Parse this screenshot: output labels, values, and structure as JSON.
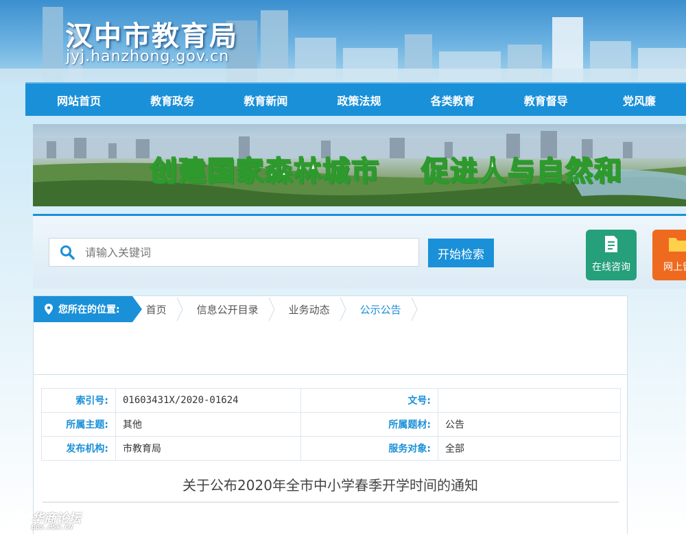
{
  "header": {
    "site_title": "汉中市教育局",
    "site_domain": "jyj.hanzhong.gov.cn"
  },
  "nav": {
    "items": [
      "网站首页",
      "教育政务",
      "教育新闻",
      "政策法规",
      "各类教育",
      "教育督导",
      "党风廉"
    ]
  },
  "banner": {
    "slogan_left": "创建国家森林城市",
    "slogan_right": "促进人与自然和"
  },
  "search": {
    "placeholder": "请输入关键词",
    "button_label": "开始检索"
  },
  "services": {
    "consult_label": "在线咨询",
    "message_label": "网上留"
  },
  "breadcrumb": {
    "label": "您所在的位置:",
    "items": [
      "首页",
      "信息公开目录",
      "业务动态",
      "公示公告"
    ]
  },
  "meta": {
    "index_no_label": "索引号:",
    "index_no": "01603431X/2020-01624",
    "doc_no_label": "文号:",
    "doc_no": "",
    "topic_label": "所属主题:",
    "topic": "其他",
    "genre_label": "所属题材:",
    "genre": "公告",
    "publisher_label": "发布机构:",
    "publisher": "市教育局",
    "audience_label": "服务对象:",
    "audience": "全部"
  },
  "document": {
    "title": "关于公布2020年全市中小学春季开学时间的通知"
  },
  "watermark": {
    "text": "华商论坛",
    "url": "BBS.HSW.CN"
  },
  "colors": {
    "primary_blue": "#1a90d8",
    "consult_green": "#26a07a",
    "message_orange": "#ee6a1f"
  }
}
